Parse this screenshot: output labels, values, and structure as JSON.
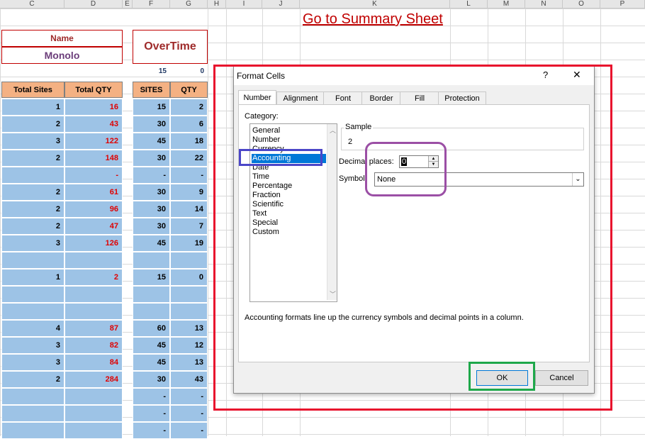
{
  "columns": [
    "C",
    "D",
    "E",
    "F",
    "G",
    "H",
    "I",
    "J",
    "K",
    "L",
    "M",
    "N",
    "O",
    "P"
  ],
  "link_text": "Go to Summary Sheet",
  "name_block": {
    "label": "Name",
    "value": "Monolo"
  },
  "overtime_block": {
    "label": "OverTime",
    "sites_total": "15",
    "qty_total": "0"
  },
  "table1_headers": [
    "Total Sites",
    "Total QTY"
  ],
  "table2_headers": [
    "SITES",
    "QTY"
  ],
  "rows": [
    {
      "c": "1",
      "d": "16",
      "f": "15",
      "g": "2"
    },
    {
      "c": "2",
      "d": "43",
      "f": "30",
      "g": "6"
    },
    {
      "c": "3",
      "d": "122",
      "f": "45",
      "g": "18"
    },
    {
      "c": "2",
      "d": "148",
      "f": "30",
      "g": "22"
    },
    {
      "c": "",
      "d": "-",
      "f": "-",
      "g": "-"
    },
    {
      "c": "2",
      "d": "61",
      "f": "30",
      "g": "9"
    },
    {
      "c": "2",
      "d": "96",
      "f": "30",
      "g": "14"
    },
    {
      "c": "2",
      "d": "47",
      "f": "30",
      "g": "7"
    },
    {
      "c": "3",
      "d": "126",
      "f": "45",
      "g": "19"
    },
    {
      "c": "",
      "d": "",
      "f": "",
      "g": ""
    },
    {
      "c": "1",
      "d": "2",
      "f": "15",
      "g": "0"
    },
    {
      "c": "",
      "d": "",
      "f": "",
      "g": ""
    },
    {
      "c": "",
      "d": "",
      "f": "",
      "g": ""
    },
    {
      "c": "4",
      "d": "87",
      "f": "60",
      "g": "13"
    },
    {
      "c": "3",
      "d": "82",
      "f": "45",
      "g": "12"
    },
    {
      "c": "3",
      "d": "84",
      "f": "45",
      "g": "13"
    },
    {
      "c": "2",
      "d": "284",
      "f": "30",
      "g": "43"
    },
    {
      "c": "",
      "d": "",
      "f": "-",
      "g": "-"
    },
    {
      "c": "",
      "d": "",
      "f": "-",
      "g": "-"
    },
    {
      "c": "",
      "d": "",
      "f": "-",
      "g": "-"
    }
  ],
  "dialog": {
    "title": "Format Cells",
    "help": "?",
    "close": "✕",
    "tabs": [
      "Number",
      "Alignment",
      "Font",
      "Border",
      "Fill",
      "Protection"
    ],
    "category_label": "Category:",
    "categories": [
      "General",
      "Number",
      "Currency",
      "Accounting",
      "Date",
      "Time",
      "Percentage",
      "Fraction",
      "Scientific",
      "Text",
      "Special",
      "Custom"
    ],
    "selected_category": "Accounting",
    "sample_label": "Sample",
    "sample_value": "2",
    "decimal_label": "Decimal places:",
    "decimal_value": "0",
    "symbol_label": "Symbol:",
    "symbol_value": "None",
    "description": "Accounting formats line up the currency symbols and decimal points in a column.",
    "ok_label": "OK",
    "cancel_label": "Cancel"
  },
  "colors": {
    "annotation_red": "#e8112d",
    "annotation_blue": "#4b46c8",
    "annotation_purple": "#9b4fa5",
    "annotation_green": "#1ea84a"
  }
}
